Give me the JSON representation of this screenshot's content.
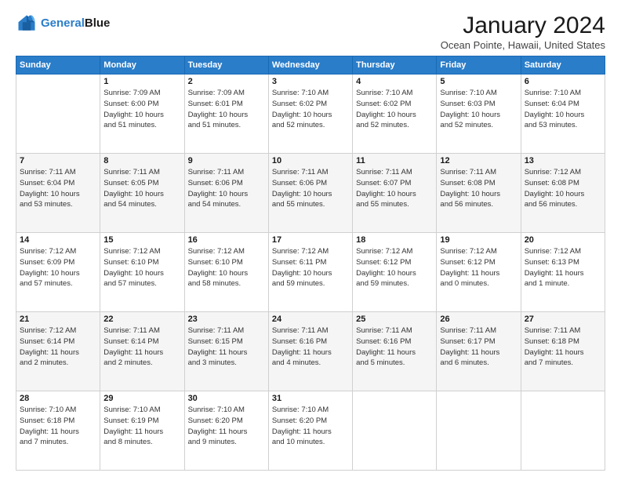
{
  "logo": {
    "text_general": "General",
    "text_blue": "Blue"
  },
  "title": "January 2024",
  "subtitle": "Ocean Pointe, Hawaii, United States",
  "days_of_week": [
    "Sunday",
    "Monday",
    "Tuesday",
    "Wednesday",
    "Thursday",
    "Friday",
    "Saturday"
  ],
  "weeks": [
    [
      {
        "day": "",
        "info": ""
      },
      {
        "day": "1",
        "info": "Sunrise: 7:09 AM\nSunset: 6:00 PM\nDaylight: 10 hours\nand 51 minutes."
      },
      {
        "day": "2",
        "info": "Sunrise: 7:09 AM\nSunset: 6:01 PM\nDaylight: 10 hours\nand 51 minutes."
      },
      {
        "day": "3",
        "info": "Sunrise: 7:10 AM\nSunset: 6:02 PM\nDaylight: 10 hours\nand 52 minutes."
      },
      {
        "day": "4",
        "info": "Sunrise: 7:10 AM\nSunset: 6:02 PM\nDaylight: 10 hours\nand 52 minutes."
      },
      {
        "day": "5",
        "info": "Sunrise: 7:10 AM\nSunset: 6:03 PM\nDaylight: 10 hours\nand 52 minutes."
      },
      {
        "day": "6",
        "info": "Sunrise: 7:10 AM\nSunset: 6:04 PM\nDaylight: 10 hours\nand 53 minutes."
      }
    ],
    [
      {
        "day": "7",
        "info": "Sunrise: 7:11 AM\nSunset: 6:04 PM\nDaylight: 10 hours\nand 53 minutes."
      },
      {
        "day": "8",
        "info": "Sunrise: 7:11 AM\nSunset: 6:05 PM\nDaylight: 10 hours\nand 54 minutes."
      },
      {
        "day": "9",
        "info": "Sunrise: 7:11 AM\nSunset: 6:06 PM\nDaylight: 10 hours\nand 54 minutes."
      },
      {
        "day": "10",
        "info": "Sunrise: 7:11 AM\nSunset: 6:06 PM\nDaylight: 10 hours\nand 55 minutes."
      },
      {
        "day": "11",
        "info": "Sunrise: 7:11 AM\nSunset: 6:07 PM\nDaylight: 10 hours\nand 55 minutes."
      },
      {
        "day": "12",
        "info": "Sunrise: 7:11 AM\nSunset: 6:08 PM\nDaylight: 10 hours\nand 56 minutes."
      },
      {
        "day": "13",
        "info": "Sunrise: 7:12 AM\nSunset: 6:08 PM\nDaylight: 10 hours\nand 56 minutes."
      }
    ],
    [
      {
        "day": "14",
        "info": "Sunrise: 7:12 AM\nSunset: 6:09 PM\nDaylight: 10 hours\nand 57 minutes."
      },
      {
        "day": "15",
        "info": "Sunrise: 7:12 AM\nSunset: 6:10 PM\nDaylight: 10 hours\nand 57 minutes."
      },
      {
        "day": "16",
        "info": "Sunrise: 7:12 AM\nSunset: 6:10 PM\nDaylight: 10 hours\nand 58 minutes."
      },
      {
        "day": "17",
        "info": "Sunrise: 7:12 AM\nSunset: 6:11 PM\nDaylight: 10 hours\nand 59 minutes."
      },
      {
        "day": "18",
        "info": "Sunrise: 7:12 AM\nSunset: 6:12 PM\nDaylight: 10 hours\nand 59 minutes."
      },
      {
        "day": "19",
        "info": "Sunrise: 7:12 AM\nSunset: 6:12 PM\nDaylight: 11 hours\nand 0 minutes."
      },
      {
        "day": "20",
        "info": "Sunrise: 7:12 AM\nSunset: 6:13 PM\nDaylight: 11 hours\nand 1 minute."
      }
    ],
    [
      {
        "day": "21",
        "info": "Sunrise: 7:12 AM\nSunset: 6:14 PM\nDaylight: 11 hours\nand 2 minutes."
      },
      {
        "day": "22",
        "info": "Sunrise: 7:11 AM\nSunset: 6:14 PM\nDaylight: 11 hours\nand 2 minutes."
      },
      {
        "day": "23",
        "info": "Sunrise: 7:11 AM\nSunset: 6:15 PM\nDaylight: 11 hours\nand 3 minutes."
      },
      {
        "day": "24",
        "info": "Sunrise: 7:11 AM\nSunset: 6:16 PM\nDaylight: 11 hours\nand 4 minutes."
      },
      {
        "day": "25",
        "info": "Sunrise: 7:11 AM\nSunset: 6:16 PM\nDaylight: 11 hours\nand 5 minutes."
      },
      {
        "day": "26",
        "info": "Sunrise: 7:11 AM\nSunset: 6:17 PM\nDaylight: 11 hours\nand 6 minutes."
      },
      {
        "day": "27",
        "info": "Sunrise: 7:11 AM\nSunset: 6:18 PM\nDaylight: 11 hours\nand 7 minutes."
      }
    ],
    [
      {
        "day": "28",
        "info": "Sunrise: 7:10 AM\nSunset: 6:18 PM\nDaylight: 11 hours\nand 7 minutes."
      },
      {
        "day": "29",
        "info": "Sunrise: 7:10 AM\nSunset: 6:19 PM\nDaylight: 11 hours\nand 8 minutes."
      },
      {
        "day": "30",
        "info": "Sunrise: 7:10 AM\nSunset: 6:20 PM\nDaylight: 11 hours\nand 9 minutes."
      },
      {
        "day": "31",
        "info": "Sunrise: 7:10 AM\nSunset: 6:20 PM\nDaylight: 11 hours\nand 10 minutes."
      },
      {
        "day": "",
        "info": ""
      },
      {
        "day": "",
        "info": ""
      },
      {
        "day": "",
        "info": ""
      }
    ]
  ]
}
